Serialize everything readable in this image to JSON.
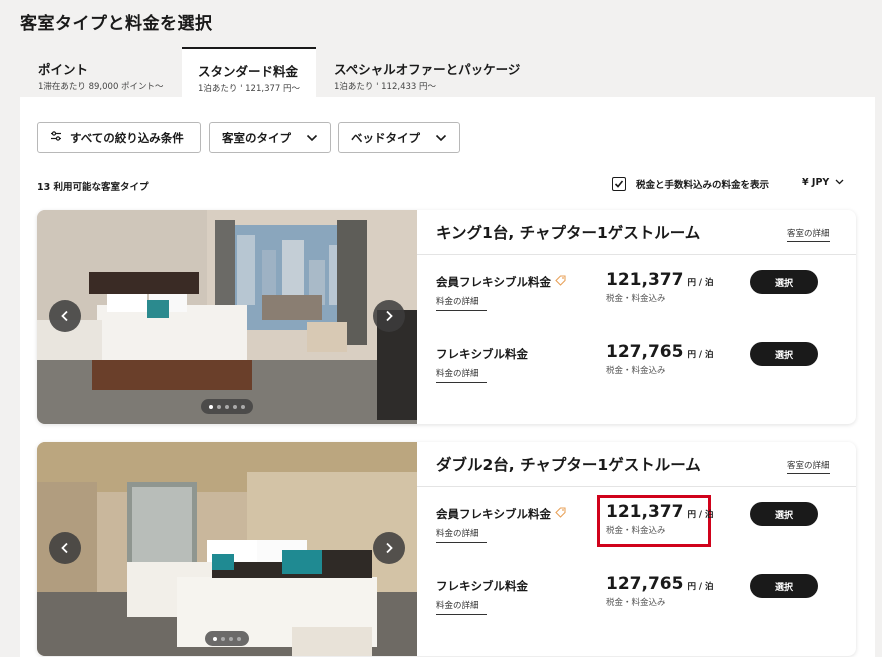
{
  "page": {
    "title": "客室タイプと料金を選択"
  },
  "tabs": [
    {
      "label": "ポイント",
      "sub": "1滞在あたり 89,000 ポイント〜"
    },
    {
      "label": "スタンダード料金",
      "sub": "1泊あたり ' 121,377 円〜"
    },
    {
      "label": "スペシャルオファーとパッケージ",
      "sub": "1泊あたり ' 112,433 円〜"
    }
  ],
  "filters": {
    "all_label": "すべての絞り込み条件",
    "room_type_label": "客室のタイプ",
    "bed_type_label": "ベッドタイプ"
  },
  "results": {
    "count_text": "13 利用可能な客室タイプ",
    "tax_label": "税金と手数料込みの料金を表示",
    "tax_checked": true,
    "currency": "¥ JPY"
  },
  "rooms": [
    {
      "title": "キング1台, チャプター1ゲストルーム",
      "detail_link": "客室の詳細",
      "rates": [
        {
          "name": "会員フレキシブル料金",
          "detail": "料金の詳細",
          "price": "121,377",
          "unit": "円 / 泊",
          "note": "税金・料金込み",
          "select": "選択"
        },
        {
          "name": "フレキシブル料金",
          "detail": "料金の詳細",
          "price": "127,765",
          "unit": "円 / 泊",
          "note": "税金・料金込み",
          "select": "選択"
        }
      ]
    },
    {
      "title": "ダブル2台, チャプター1ゲストルーム",
      "detail_link": "客室の詳細",
      "rates": [
        {
          "name": "会員フレキシブル料金",
          "detail": "料金の詳細",
          "price": "121,377",
          "unit": "円 / 泊",
          "note": "税金・料金込み",
          "select": "選択"
        },
        {
          "name": "フレキシブル料金",
          "detail": "料金の詳細",
          "price": "127,765",
          "unit": "円 / 泊",
          "note": "税金・料金込み",
          "select": "選択"
        }
      ]
    }
  ],
  "colors": {
    "highlight": "#d0021b",
    "accent": "#1a1a1a",
    "tag": "#e8a25a"
  }
}
